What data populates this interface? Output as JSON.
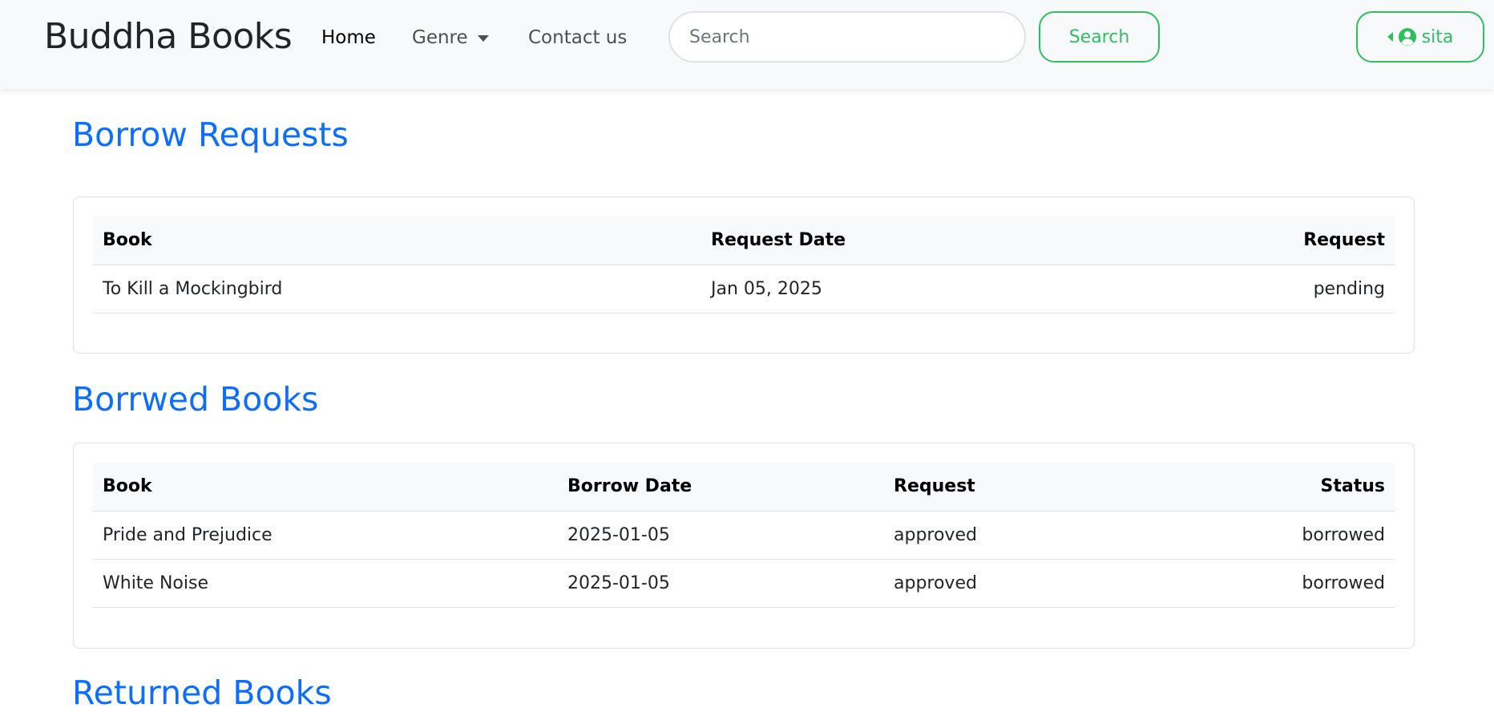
{
  "navbar": {
    "brand": "Buddha Books",
    "links": {
      "home": "Home",
      "genre": "Genre",
      "contact": "Contact us"
    },
    "search_placeholder": "Search",
    "search_button": "Search",
    "user_name": "sita",
    "accent_color": "#2fbf60"
  },
  "borrow_requests": {
    "title": "Borrow Requests",
    "headers": [
      "Book",
      "Request Date",
      "Request"
    ],
    "rows": [
      [
        "To Kill a Mockingbird",
        "Jan 05, 2025",
        "pending"
      ]
    ]
  },
  "borrowed_books": {
    "title": "Borrwed Books",
    "headers": [
      "Book",
      "Borrow Date",
      "Request",
      "Status"
    ],
    "rows": [
      [
        "Pride and Prejudice",
        "2025-01-05",
        "approved",
        "borrowed"
      ],
      [
        "White Noise",
        "2025-01-05",
        "approved",
        "borrowed"
      ]
    ]
  },
  "returned_books": {
    "title": "Returned Books"
  },
  "colors": {
    "heading": "#0d6efd",
    "navbar_bg": "#f8f9fa",
    "border": "#dee2e6"
  },
  "icons": {
    "user": "user-circle-icon",
    "genre_caret": "caret-down-icon",
    "user_caret": "caret-left-icon"
  }
}
